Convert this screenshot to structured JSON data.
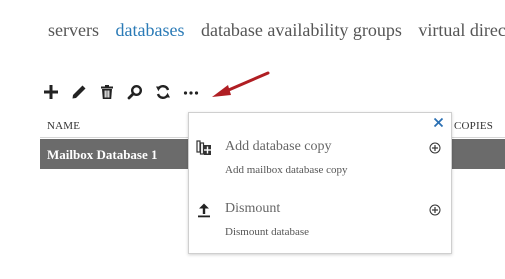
{
  "tabs": [
    {
      "label": "servers",
      "active": false
    },
    {
      "label": "databases",
      "active": true
    },
    {
      "label": "database availability groups",
      "active": false
    },
    {
      "label": "virtual directories",
      "active": false
    }
  ],
  "toolbar": {
    "buttons": [
      {
        "icon": "plus-icon",
        "tooltip": "New"
      },
      {
        "icon": "pencil-icon",
        "tooltip": "Edit"
      },
      {
        "icon": "trash-icon",
        "tooltip": "Delete"
      },
      {
        "icon": "search-icon",
        "tooltip": "Search"
      },
      {
        "icon": "refresh-icon",
        "tooltip": "Refresh"
      },
      {
        "icon": "more-icon",
        "tooltip": "More options"
      }
    ]
  },
  "table": {
    "columns": [
      "NAME",
      "COPIES"
    ],
    "selected_row": {
      "name": "Mailbox Database 1"
    }
  },
  "popup": {
    "close_icon": "close-icon",
    "items": [
      {
        "label": "Add database copy",
        "description": "Add mailbox database copy",
        "icon": "database-copy-icon",
        "expand_icon": "plus-circle-icon"
      },
      {
        "label": "Dismount",
        "description": "Dismount database",
        "icon": "dismount-icon",
        "expand_icon": "plus-circle-icon"
      }
    ]
  },
  "colors": {
    "active_tab": "#2a7ab6",
    "selected_row_bg": "#6b6b6b",
    "annotation_arrow": "#b01e23"
  }
}
